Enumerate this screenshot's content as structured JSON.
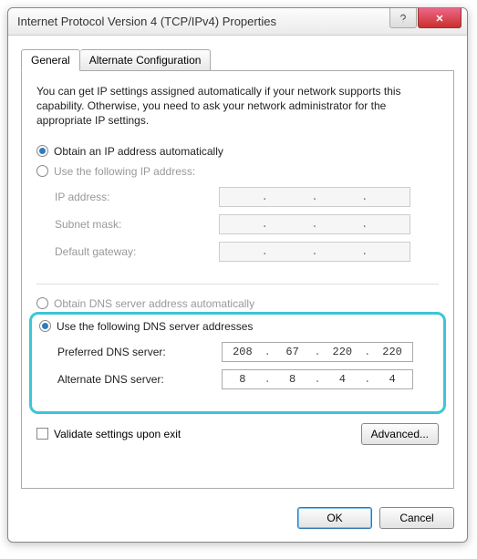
{
  "window": {
    "title": "Internet Protocol Version 4 (TCP/IPv4) Properties"
  },
  "tabs": {
    "general": "General",
    "alternate": "Alternate Configuration"
  },
  "intro": "You can get IP settings assigned automatically if your network supports this capability. Otherwise, you need to ask your network administrator for the appropriate IP settings.",
  "ip": {
    "auto_label": "Obtain an IP address automatically",
    "manual_label": "Use the following IP address:",
    "address_label": "IP address:",
    "subnet_label": "Subnet mask:",
    "gateway_label": "Default gateway:"
  },
  "dns": {
    "auto_label": "Obtain DNS server address automatically",
    "manual_label": "Use the following DNS server addresses",
    "preferred_label": "Preferred DNS server:",
    "alternate_label": "Alternate DNS server:",
    "preferred": {
      "o1": "208",
      "o2": "67",
      "o3": "220",
      "o4": "220"
    },
    "alternate": {
      "o1": "8",
      "o2": "8",
      "o3": "4",
      "o4": "4"
    }
  },
  "validate_label": "Validate settings upon exit",
  "advanced_btn": "Advanced...",
  "ok_btn": "OK",
  "cancel_btn": "Cancel"
}
